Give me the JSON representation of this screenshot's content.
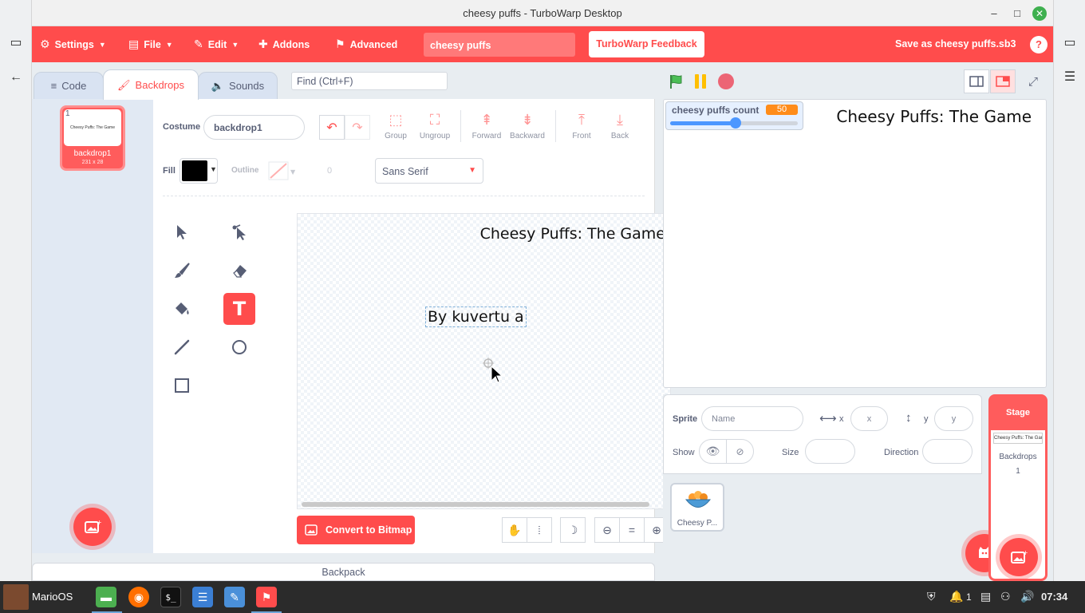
{
  "window": {
    "title": "cheesy puffs - TurboWarp Desktop",
    "minimize": "–",
    "maximize": "□",
    "close": "✕"
  },
  "menubar": {
    "settings": "Settings",
    "file": "File",
    "edit": "Edit",
    "addons": "Addons",
    "advanced": "Advanced",
    "project_title": "cheesy puffs",
    "feedback": "TurboWarp Feedback",
    "save": "Save as cheesy puffs.sb3",
    "help": "?"
  },
  "tabs": {
    "code": "Code",
    "backdrops": "Backdrops",
    "sounds": "Sounds"
  },
  "find": {
    "placeholder": "Find (Ctrl+F)"
  },
  "costume_list": [
    {
      "number": "1",
      "name": "backdrop1",
      "size": "231 x 28",
      "thumb_text": "Cheesy Puffs: The Game"
    }
  ],
  "paint_editor": {
    "costume_label": "Costume",
    "costume_name": "backdrop1",
    "undo": "↶",
    "redo": "↷",
    "group": "Group",
    "ungroup": "Ungroup",
    "forward": "Forward",
    "backward": "Backward",
    "front": "Front",
    "back": "Back",
    "fill_label": "Fill",
    "fill_color": "#000000",
    "outline_label": "Outline",
    "outline_width": "0",
    "font": "Sans Serif",
    "canvas_title": "Cheesy Puffs: The Game",
    "canvas_text": "By kuvertu a",
    "convert": "Convert to Bitmap",
    "zoom_reset": "="
  },
  "stage": {
    "monitor_label": "cheesy puffs count",
    "monitor_value": "50",
    "title_text": "Cheesy Puffs: The Game"
  },
  "sprite_info": {
    "sprite_label": "Sprite",
    "name_placeholder": "Name",
    "x_label": "x",
    "x_placeholder": "x",
    "y_label": "y",
    "y_placeholder": "y",
    "show_label": "Show",
    "size_label": "Size",
    "direction_label": "Direction"
  },
  "sprites": [
    {
      "name": "Cheesy P..."
    }
  ],
  "stage_target": {
    "label": "Stage",
    "thumb_text": "Cheesy Puffs: The Gam",
    "backdrops_label": "Backdrops",
    "backdrops_count": "1"
  },
  "backpack": "Backpack",
  "taskbar": {
    "user": "MarioOS",
    "notifications": "1",
    "time": "07:34"
  },
  "colors": {
    "accent": "#ff4c4c",
    "monitor_orange": "#ff8c1a",
    "slider_blue": "#4c97ff",
    "flag_green": "#4cbf56",
    "pause_yellow": "#ffbf00",
    "stop_red": "#ec6575"
  }
}
